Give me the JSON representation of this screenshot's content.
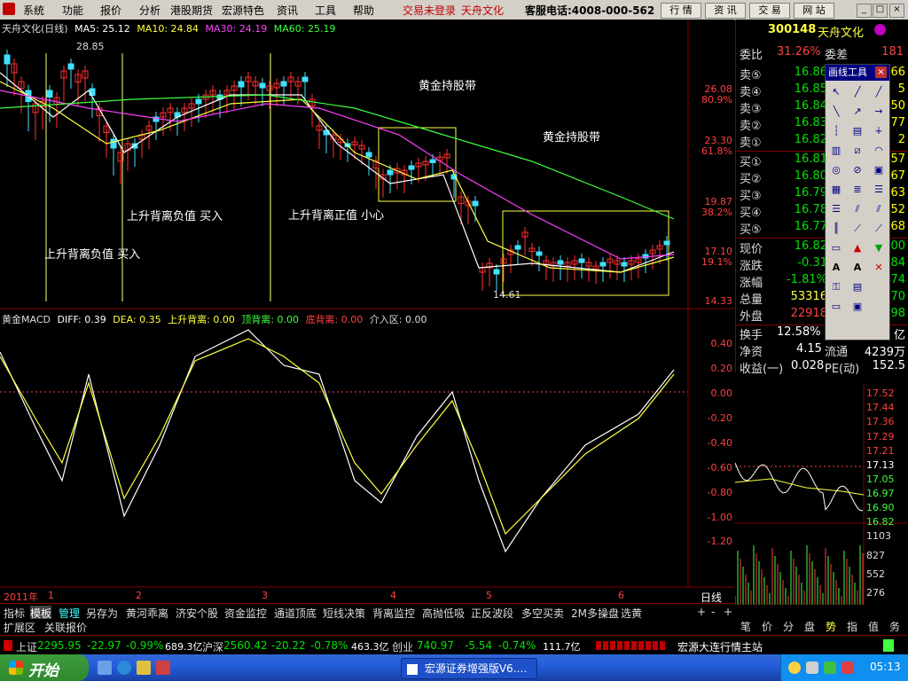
{
  "menu": {
    "items": [
      "系统",
      "功能",
      "报价",
      "分析",
      "港股期货",
      "宏源特色",
      "资讯",
      "工具",
      "帮助"
    ],
    "login_status": "交易未登录",
    "app_name": "天舟文化",
    "service_phone": "客服电话:4008-000-562",
    "buttons": [
      "行 情",
      "资 讯",
      "交 易",
      "网 站"
    ]
  },
  "chart": {
    "title": "天舟文化(日线)",
    "ma5": "MA5: 25.12",
    "ma10": "MA10: 24.84",
    "ma30": "MA30: 24.19",
    "ma60": "MA60: 25.19",
    "high_marker": "28.85",
    "low_marker": "14.61",
    "price_axis": [
      "26.08",
      "80.9%",
      "23.30",
      "61.8%",
      "19.87",
      "38.2%",
      "17.10",
      "19.1%",
      "14.33"
    ],
    "annotations": [
      "上升背离负值 买入",
      "上升背离负值 买入",
      "上升背离正值 小心",
      "黄金持股带",
      "黄金持股带"
    ],
    "indicator_title": "黄金MACD",
    "diff": "DIFF: 0.39",
    "dea": "DEA: 0.35",
    "up_div": "上升背离: 0.00",
    "top_div": "顶背离: 0.00",
    "bot_div": "底背离: 0.00",
    "entry": "介入区: 0.00",
    "macd_axis": [
      "0.40",
      "0.20",
      "0.00",
      "-0.20",
      "-0.40",
      "-0.60",
      "-0.80",
      "-1.00",
      "-1.20"
    ],
    "time_axis": [
      "2011年",
      "1",
      "2",
      "3",
      "4",
      "5",
      "6"
    ],
    "period": "日线",
    "colors": {
      "up": "#ff3030",
      "down": "#40e0ff",
      "ma5": "#ffffff",
      "ma10": "#ffff40",
      "ma30": "#ff40ff",
      "ma60": "#40ff40"
    }
  },
  "tabs": {
    "row1": [
      "指标",
      "模板",
      "管理",
      "另存为",
      "黄河乖离",
      "济安个股",
      "资金监控",
      "通道顶底",
      "短线决策",
      "背离监控",
      "高抛低吸",
      "正反波段",
      "多空买卖",
      "2M多操盘",
      "选黄"
    ],
    "row2": [
      "扩展区",
      "关联报价"
    ],
    "zoom_buttons": [
      "+",
      "-",
      "+"
    ]
  },
  "quote": {
    "code": "300148",
    "name": "天舟文化",
    "weibi_label": "委比",
    "weibi": "31.26%",
    "weicha_label": "委差",
    "weicha": "181",
    "sells": [
      {
        "label": "卖⑤",
        "price": "16.86",
        "vol": "66"
      },
      {
        "label": "卖④",
        "price": "16.85",
        "vol": "5"
      },
      {
        "label": "卖③",
        "price": "16.84",
        "vol": "50"
      },
      {
        "label": "卖②",
        "price": "16.83",
        "vol": "77"
      },
      {
        "label": "卖①",
        "price": "16.82",
        "vol": "2"
      }
    ],
    "buys": [
      {
        "label": "买①",
        "price": "16.81",
        "vol": "57"
      },
      {
        "label": "买②",
        "price": "16.80",
        "vol": "67"
      },
      {
        "label": "买③",
        "price": "16.79",
        "vol": "63"
      },
      {
        "label": "买④",
        "price": "16.78",
        "vol": "52"
      },
      {
        "label": "买⑤",
        "price": "16.77",
        "vol": "68"
      }
    ],
    "stats": [
      {
        "label": "现价",
        "value": "16.82",
        "extra": "00"
      },
      {
        "label": "涨跌",
        "value": "-0.31",
        "extra": "84"
      },
      {
        "label": "涨幅",
        "value": "-1.81%",
        "extra": "74"
      },
      {
        "label": "总量",
        "value": "53316",
        "extra": "70"
      },
      {
        "label": "外盘",
        "value": "22918",
        "extra": "98"
      }
    ],
    "huanshou_label": "换手",
    "huanshou": "12.58%",
    "yi": "亿",
    "jingzi_label": "净资",
    "jingzi": "4.15",
    "liutong_label": "流通",
    "liutong": "4239万",
    "shouyi_label": "收益(一)",
    "shouyi": "0.028",
    "pe_label": "PE(动)",
    "pe": "152.5"
  },
  "tools": {
    "title": "画线工具"
  },
  "mini": {
    "price_axis": [
      "17.52",
      "17.44",
      "17.36",
      "17.29",
      "17.21",
      "17.13",
      "17.05",
      "16.97",
      "16.90",
      "16.82"
    ],
    "vol_axis": [
      "1103",
      "827",
      "552",
      "276"
    ],
    "tabs": [
      "笔",
      "价",
      "分",
      "盘",
      "势",
      "指",
      "值",
      "务"
    ]
  },
  "ticker": {
    "sh_label": "上证",
    "sh": "2295.95",
    "sh_chg": "-22.97",
    "sh_pct": "-0.99%",
    "sh_amt": "689.3亿",
    "sz_label": "沪深",
    "sz": "2560.42",
    "sz_chg": "-20.22",
    "sz_pct": "-0.78%",
    "sz_amt": "463.3亿",
    "cy_label": "创业",
    "cy": "740.97",
    "cy_chg": "-5.54",
    "cy_pct": "-0.74%",
    "cy_amt": "111.7亿",
    "server": "宏源大连行情主站"
  },
  "taskbar": {
    "start": "开始",
    "item": "宏源证券增强版V6.…",
    "time": "05:13"
  }
}
